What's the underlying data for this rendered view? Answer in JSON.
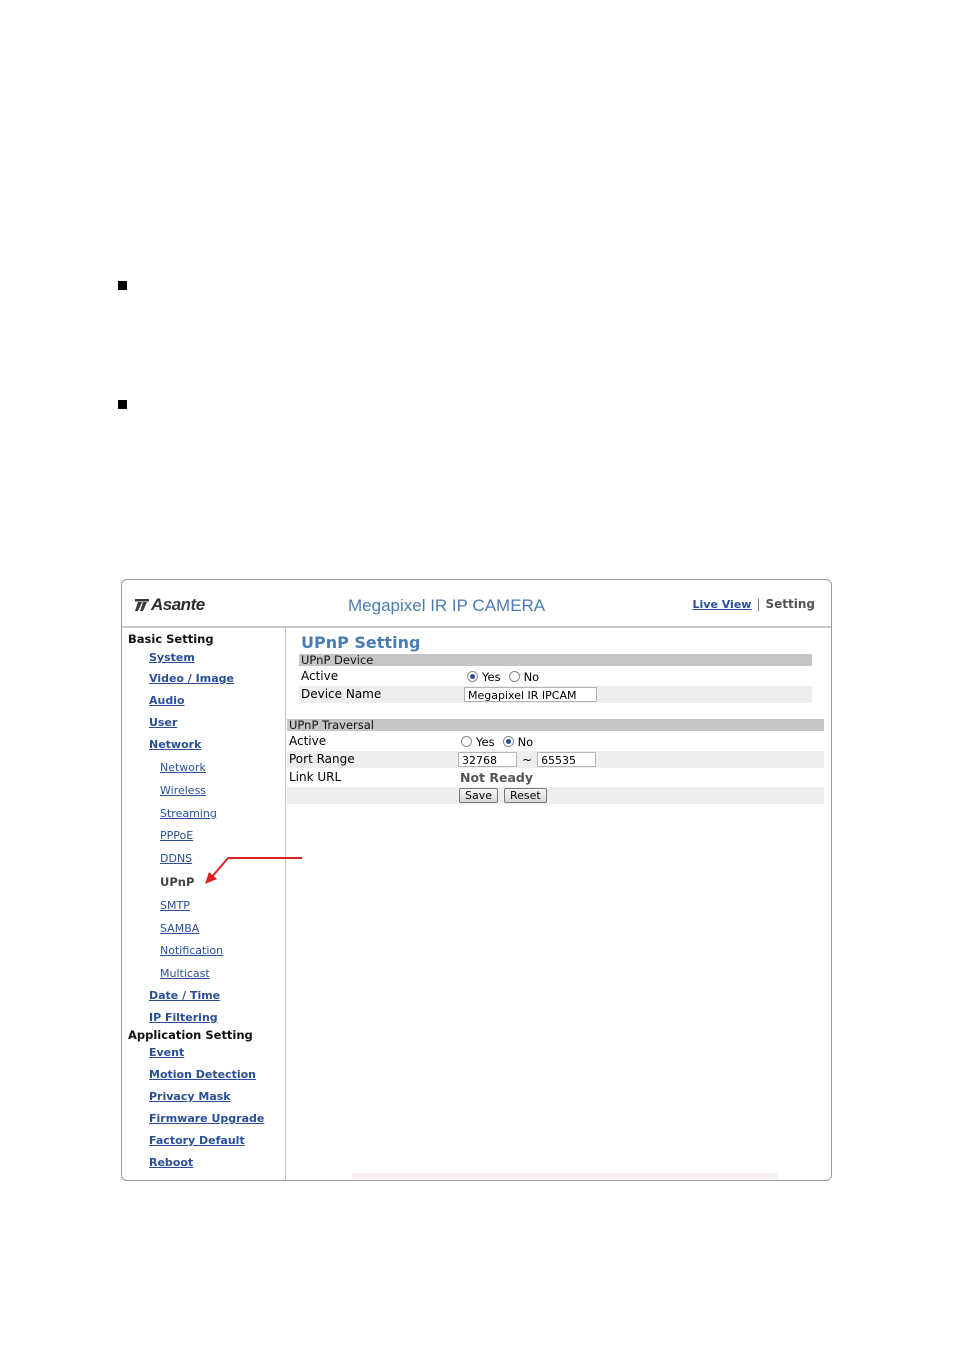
{
  "header": {
    "logo_text": "Asante",
    "camera_title": "Megapixel IR IP CAMERA",
    "live_view_label": "Live View",
    "separator": "|",
    "setting_label": "Setting"
  },
  "sidebar": {
    "basic_setting_label": "Basic Setting",
    "system": "System",
    "video_image": "Video / Image",
    "audio": "Audio",
    "user": "User",
    "network": "Network",
    "network_sub": {
      "network": "Network",
      "wireless": "Wireless",
      "streaming": "Streaming",
      "pppoe": "PPPoE",
      "ddns": "DDNS",
      "upnp": "UPnP",
      "smtp": "SMTP",
      "samba": "SAMBA",
      "notification": "Notification",
      "multicast": "Multicast"
    },
    "date_time": "Date / Time",
    "ip_filtering": "IP Filtering",
    "application_setting_label": "Application Setting",
    "event": "Event",
    "motion_detection": "Motion Detection",
    "privacy_mask": "Privacy Mask",
    "firmware_upgrade": "Firmware Upgrade",
    "factory_default": "Factory Default",
    "reboot": "Reboot"
  },
  "main": {
    "page_title": "UPnP Setting",
    "upnp_device": {
      "section_label": "UPnP Device",
      "active_label": "Active",
      "active_options": [
        "Yes",
        "No"
      ],
      "active_selected": "Yes",
      "device_name_label": "Device Name",
      "device_name_value": "Megapixel IR IPCAM"
    },
    "upnp_traversal": {
      "section_label": "UPnP Traversal",
      "active_label": "Active",
      "active_options": [
        "Yes",
        "No"
      ],
      "active_selected": "No",
      "port_range_label": "Port Range",
      "port_from": "32768",
      "port_separator": "~",
      "port_to": "65535",
      "link_url_label": "Link URL",
      "link_url_status": "Not Ready"
    },
    "save_label": "Save",
    "reset_label": "Reset"
  },
  "colors": {
    "title_blue": "#4a7db3",
    "link_blue": "#2a4f9a",
    "section_bar": "#c6c6c6",
    "annotation_arrow": "#e02020"
  }
}
